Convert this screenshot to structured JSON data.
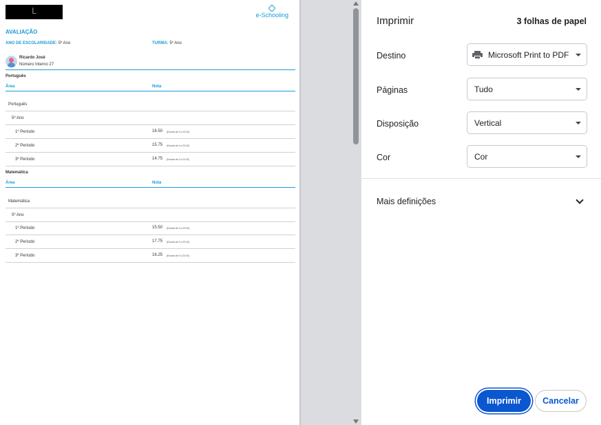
{
  "document": {
    "redacted_logo_char": "L",
    "brand": "e-Schooling",
    "section_title": "AVALIAÇÃO",
    "year_label": "ANO DE ESCOLARIDADE:",
    "year_value": "5º Ano",
    "class_label": "TURMA:",
    "class_value": "5º Ano",
    "student_name": "Ricardo José",
    "student_number": "Número Interno 27",
    "col_area": "Área",
    "col_grade": "Nota",
    "subjects": [
      {
        "title": "Português",
        "area": "Português",
        "year": "5º Ano",
        "periods": [
          {
            "label": "1º Período",
            "grade": "16.50",
            "scale": "(Escala de 0 a 20.00)"
          },
          {
            "label": "2º Período",
            "grade": "15.75",
            "scale": "(Escala de 0 a 20.00)"
          },
          {
            "label": "3º Período",
            "grade": "14.75",
            "scale": "(Escala de 0 a 20.00)"
          }
        ]
      },
      {
        "title": "Matemática",
        "area": "Matemática",
        "year": "5º Ano",
        "periods": [
          {
            "label": "1º Período",
            "grade": "15.50",
            "scale": "(Escala de 0 a 20.00)"
          },
          {
            "label": "2º Período",
            "grade": "17.75",
            "scale": "(Escala de 0 a 20.00)"
          },
          {
            "label": "3º Período",
            "grade": "16.25",
            "scale": "(Escala de 0 a 20.00)"
          }
        ]
      }
    ]
  },
  "panel": {
    "title": "Imprimir",
    "sheets": "3 folhas de papel",
    "destination_label": "Destino",
    "destination_value": "Microsoft Print to PDF",
    "pages_label": "Páginas",
    "pages_value": "Tudo",
    "layout_label": "Disposição",
    "layout_value": "Vertical",
    "color_label": "Cor",
    "color_value": "Cor",
    "more_settings": "Mais definições",
    "print_button": "Imprimir",
    "cancel_button": "Cancelar"
  },
  "colors": {
    "accent_blue": "#1a9bd7",
    "primary_button": "#0b57d0"
  }
}
